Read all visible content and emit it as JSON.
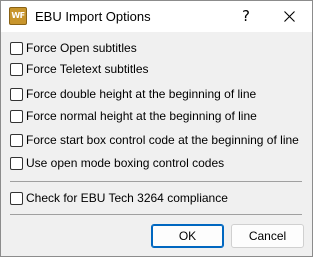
{
  "window": {
    "title": "EBU Import Options",
    "app_icon_text": "WF",
    "help_label": "?",
    "close_icon": "close-icon"
  },
  "options": {
    "force_open_subtitles": {
      "label": "Force Open subtitles",
      "checked": false
    },
    "force_teletext_subtitles": {
      "label": "Force Teletext subtitles",
      "checked": false
    },
    "force_double_height": {
      "label": "Force double height at the beginning of line",
      "checked": false
    },
    "force_normal_height": {
      "label": "Force normal height at the beginning of line",
      "checked": false
    },
    "force_start_box": {
      "label": "Force start box control code at the beginning of line",
      "checked": false
    },
    "open_mode_boxing": {
      "label": "Use open mode boxing control codes",
      "checked": false
    },
    "ebu_tech_3264": {
      "label": "Check for EBU Tech 3264 compliance",
      "checked": false
    }
  },
  "buttons": {
    "ok_label": "OK",
    "cancel_label": "Cancel"
  }
}
